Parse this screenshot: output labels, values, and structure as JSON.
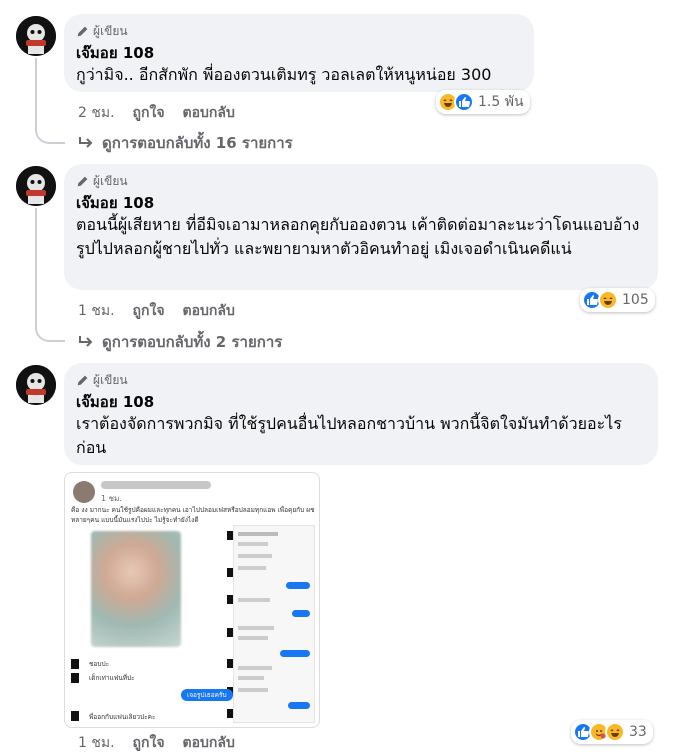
{
  "comments": [
    {
      "badge": "ผู้เขียน",
      "author": "เจ๊มอย 108",
      "text": "กูว่ามิจ.. อีกสักพัก พี่อองตวนเติมทรู วอลเลตให้หนูหน่อย 300",
      "time": "2 ชม.",
      "like_label": "ถูกใจ",
      "reply_label": "ตอบกลับ",
      "reaction_count": "1.5 พัน",
      "view_replies": "ดูการตอบกลับทั้ง 16 รายการ"
    },
    {
      "badge": "ผู้เขียน",
      "author": "เจ๊มอย 108",
      "text": "ตอนนี้ผู้เสียหาย ที่อีมิจเอามาหลอกคุยกับอองตวน เค้าติดต่อมาละนะว่าโดนแอบอ้างรูปไปหลอกผู้ชายไปทั่ว และพยายามหาตัวอิคนทำอยู่ เมิงเจอดำเนินคดีแน่",
      "time": "1 ชม.",
      "like_label": "ถูกใจ",
      "reply_label": "ตอบกลับ",
      "reaction_count": "105",
      "view_replies": "ดูการตอบกลับทั้ง 2 รายการ"
    },
    {
      "badge": "ผู้เขียน",
      "author": "เจ๊มอย 108",
      "text": "เราต้องจัดการพวกมิจ ที่ใช้รูปคนอื่นไปหลอกชาวบ้าน พวกนี้จิตใจมันทำด้วยอะไรก่อน",
      "time": "1 ชม.",
      "like_label": "ถูกใจ",
      "reply_label": "ตอบกลับ",
      "reaction_count": "33"
    }
  ],
  "attachment": {
    "post_time": "1 ชม.",
    "post_text": "คือ งง มากนะ คนใช้รูปคือผมและทุกคน เอาไปปลอมเฟสหรือปลอมทุกแอพ เพื่อคุยกับ ผช หลายๆคน แบบนี้มันแรงไปปะ ไม่รู้จะทำยังไงดี",
    "chat_button": "เจอรูปเธอครับ",
    "chat_line1": "ชอบปะ",
    "chat_line2": "เด็กเท่าแฟนที่ปะ",
    "chat_line3": "พี่ออกกับแฟนเลิยวปะคะ"
  },
  "colors": {
    "bubble": "#f0f2f5",
    "secondary_text": "#65676b",
    "like_blue": "#1877f2",
    "haha_yellow": "#f7b928"
  }
}
